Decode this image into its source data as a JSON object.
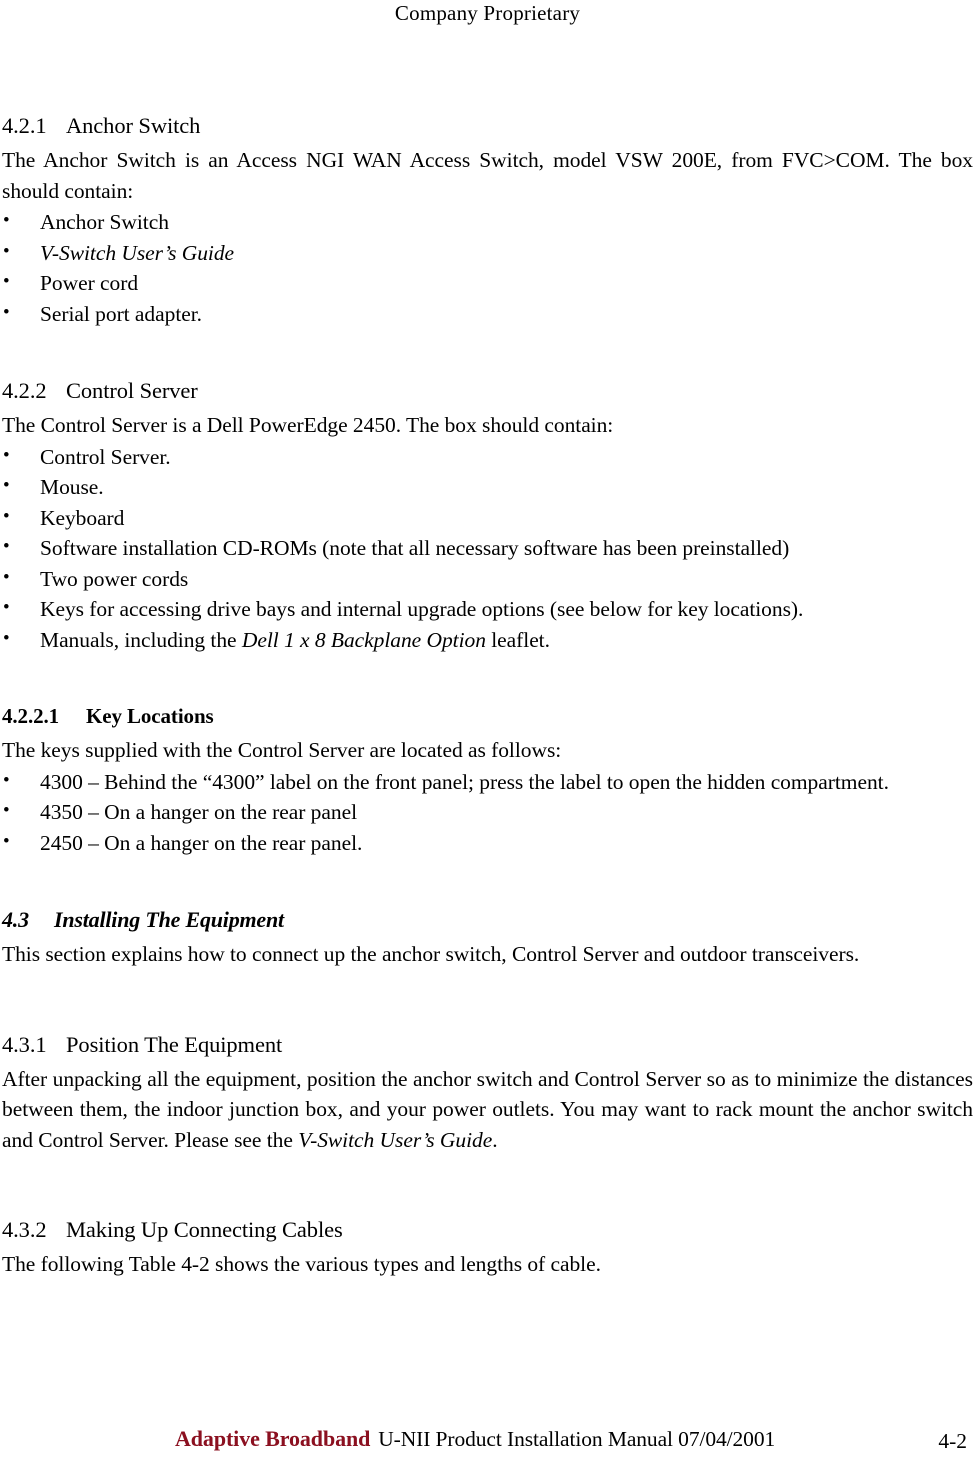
{
  "header": {
    "running_head": "Company Proprietary"
  },
  "footer": {
    "brand": "Adaptive Broadband",
    "title": "U-NII Product Installation Manual  07/04/2001",
    "page_number": "4-2"
  },
  "colors": {
    "brand_red": "#8B1020",
    "text": "#000000",
    "background": "#ffffff"
  },
  "sections": {
    "anchor_switch": {
      "number": "4.2.1",
      "title": "Anchor Switch",
      "intro": "The Anchor Switch is an Access NGI WAN Access Switch, model VSW 200E, from FVC>COM.  The box should contain:",
      "items": [
        {
          "text": "Anchor Switch",
          "italic": false
        },
        {
          "text": "V-Switch User’s Guide",
          "italic": true
        },
        {
          "text": "Power cord",
          "italic": false
        },
        {
          "text": "Serial port adapter.",
          "italic": false
        }
      ]
    },
    "control_server": {
      "number": "4.2.2",
      "title": "Control Server",
      "intro": "The Control Server is a Dell PowerEdge 2450.  The box should contain:",
      "items": [
        {
          "pre": " Control Server.",
          "ital": "",
          "post": ""
        },
        {
          "pre": "Mouse.",
          "ital": "",
          "post": ""
        },
        {
          "pre": "Keyboard",
          "ital": "",
          "post": ""
        },
        {
          "pre": "Software installation CD-ROMs (note that all necessary software has been preinstalled)",
          "ital": "",
          "post": ""
        },
        {
          "pre": "Two power cords",
          "ital": "",
          "post": ""
        },
        {
          "pre": "Keys for accessing drive bays and internal upgrade options (see below for key locations).",
          "ital": "",
          "post": ""
        },
        {
          "pre": "Manuals, including the ",
          "ital": "Dell 1 x 8 Backplane Option",
          "post": " leaflet."
        }
      ]
    },
    "key_locations": {
      "number": "4.2.2.1",
      "title": "Key Locations",
      "intro": "The keys supplied with the Control Server are located as follows:",
      "items": [
        {
          "text": "4300 – Behind the “4300” label on the front panel; press the label to open the hidden compartment.",
          "justify": true
        },
        {
          "text": "4350 – On a hanger on the rear panel",
          "justify": false
        },
        {
          "text": "2450 – On a hanger on the rear panel.",
          "justify": false
        }
      ]
    },
    "installing": {
      "number": "4.3",
      "title": "Installing The Equipment",
      "intro": "This section explains how to connect up the anchor switch, Control Server and outdoor transceivers."
    },
    "position_equipment": {
      "number": "4.3.1",
      "title": "Position The Equipment",
      "body_pre": "After unpacking all the equipment, position the anchor switch and Control Server so as to minimize the distances between them, the indoor junction box, and your power outlets.  You may want to rack mount the anchor switch and Control Server.  Please see the ",
      "body_ital": "V-Switch User’s Guide",
      "body_post": "."
    },
    "making_cables": {
      "number": "4.3.2",
      "title": "Making Up Connecting Cables",
      "intro": "The following Table 4-2 shows the various types and lengths of cable."
    }
  },
  "glyphs": {
    "bullet": "•"
  }
}
